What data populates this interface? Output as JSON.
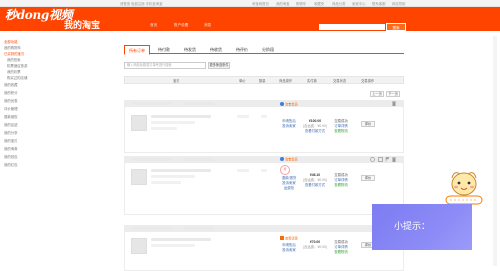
{
  "topbar": {
    "left": "请登录 免费注册 手机逛淘宝",
    "right": [
      "淘宝网首页",
      "我的淘宝",
      "购物车",
      "收藏夹",
      "商品分类",
      "卖家中心",
      "联系客服",
      "网站导航"
    ]
  },
  "header": {
    "logo": "秒dong视频",
    "brand": "我的淘宝",
    "nav": [
      "首页",
      "账户设置",
      "消息"
    ],
    "search_button": "搜索",
    "search_placeholder": ""
  },
  "sidebar": [
    {
      "label": "全部功能",
      "type": "h"
    },
    {
      "label": "我的购物车",
      "type": "i"
    },
    {
      "label": "已买到的宝贝",
      "type": "h"
    },
    {
      "label": "我的拍卖",
      "type": "i"
    },
    {
      "label": "机票酒店旅游",
      "type": "i"
    },
    {
      "label": "我的彩票",
      "type": "i"
    },
    {
      "label": "购买过的店铺",
      "type": "i"
    },
    {
      "label": "我的收藏",
      "type": "i"
    },
    {
      "label": "我的积分",
      "type": "i"
    },
    {
      "label": "我的优惠",
      "type": "i"
    },
    {
      "label": "评价管理",
      "type": "i"
    },
    {
      "label": "退款维权",
      "type": "i"
    },
    {
      "label": "我的足迹",
      "type": "i"
    },
    {
      "label": "我的分享",
      "type": "i"
    },
    {
      "label": "我的宝贝",
      "type": "i"
    },
    {
      "label": "我的淘券",
      "type": "i"
    },
    {
      "label": "我的钱包",
      "type": "i"
    },
    {
      "label": "我的红包",
      "type": "i"
    }
  ],
  "tabs": [
    "所有订单",
    "待付款",
    "待发货",
    "待收货",
    "待评价",
    "分阶段"
  ],
  "orders_search": {
    "placeholder": "输入商品标题或订单号进行搜索",
    "button": "更多筛选条件"
  },
  "table_header": [
    "宝贝",
    "单价",
    "数量",
    "商品操作",
    "实付款",
    "交易状态",
    "交易操作"
  ],
  "pager": {
    "prev": "上一页",
    "next": "下一页"
  },
  "orders": [
    {
      "badge": "淘宝会员",
      "ops": [
        "申请售后",
        "投诉卖家"
      ],
      "price": "¥100.00",
      "shipping": "(含运费：¥0.00)",
      "pay_note": "查看付款方式",
      "status": [
        "交易成功",
        "订单详情",
        "查看物流"
      ],
      "action": "评价"
    },
    {
      "badge": "淘宝会员",
      "ops": [
        "退款/退货",
        "投诉卖家",
        "运费险"
      ],
      "price": "¥46.10",
      "shipping": "(含运费：¥0.00)",
      "pay_note": "查看付款方式",
      "status": [
        "交易成功",
        "订单详情",
        "查看物流"
      ],
      "action": "评价"
    },
    {
      "badge": "查看优惠",
      "ops": [
        "申请售后",
        "投诉卖家"
      ],
      "price": "¥70.00",
      "shipping": "(含运费：¥0.00)",
      "pay_note": "",
      "status": [
        "交易成功",
        "订单详情",
        "查看物流"
      ],
      "action": "评价"
    }
  ],
  "tip": {
    "text": "小提示："
  },
  "colors": {
    "brand": "#ff4400",
    "tip_panel": "#8584f4"
  }
}
